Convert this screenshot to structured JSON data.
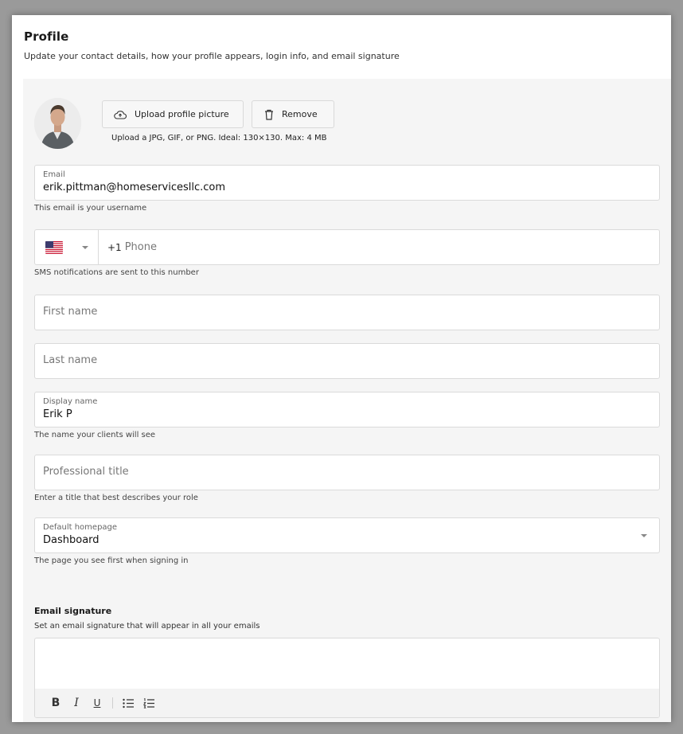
{
  "header": {
    "title": "Profile",
    "subtitle": "Update your contact details, how your profile appears, login info, and email signature"
  },
  "photo": {
    "upload_label": "Upload profile picture",
    "remove_label": "Remove",
    "hint": "Upload a JPG, GIF, or PNG. Ideal: 130×130. Max: 4 MB"
  },
  "email": {
    "label": "Email",
    "value": "erik.pittman@homeservicesllc.com",
    "helper": "This email is your username"
  },
  "phone": {
    "country": "US",
    "prefix": "+1",
    "placeholder": "Phone",
    "helper": "SMS notifications are sent to this number"
  },
  "first_name": {
    "placeholder": "First name"
  },
  "last_name": {
    "placeholder": "Last name"
  },
  "display_name": {
    "label": "Display name",
    "value": "Erik P",
    "helper": "The name your clients will see"
  },
  "professional_title": {
    "placeholder": "Professional title",
    "helper": "Enter a title that best describes your role"
  },
  "default_homepage": {
    "label": "Default homepage",
    "value": "Dashboard",
    "helper": "The page you see first when signing in"
  },
  "signature": {
    "title": "Email signature",
    "subtitle": "Set an email signature that will appear in all your emails",
    "toolbar": {
      "bold": "B",
      "italic": "I",
      "underline": "U"
    }
  },
  "colors": {
    "background": "#f5f5f5",
    "field_border": "#dadada",
    "text": "#1a1a1a"
  }
}
